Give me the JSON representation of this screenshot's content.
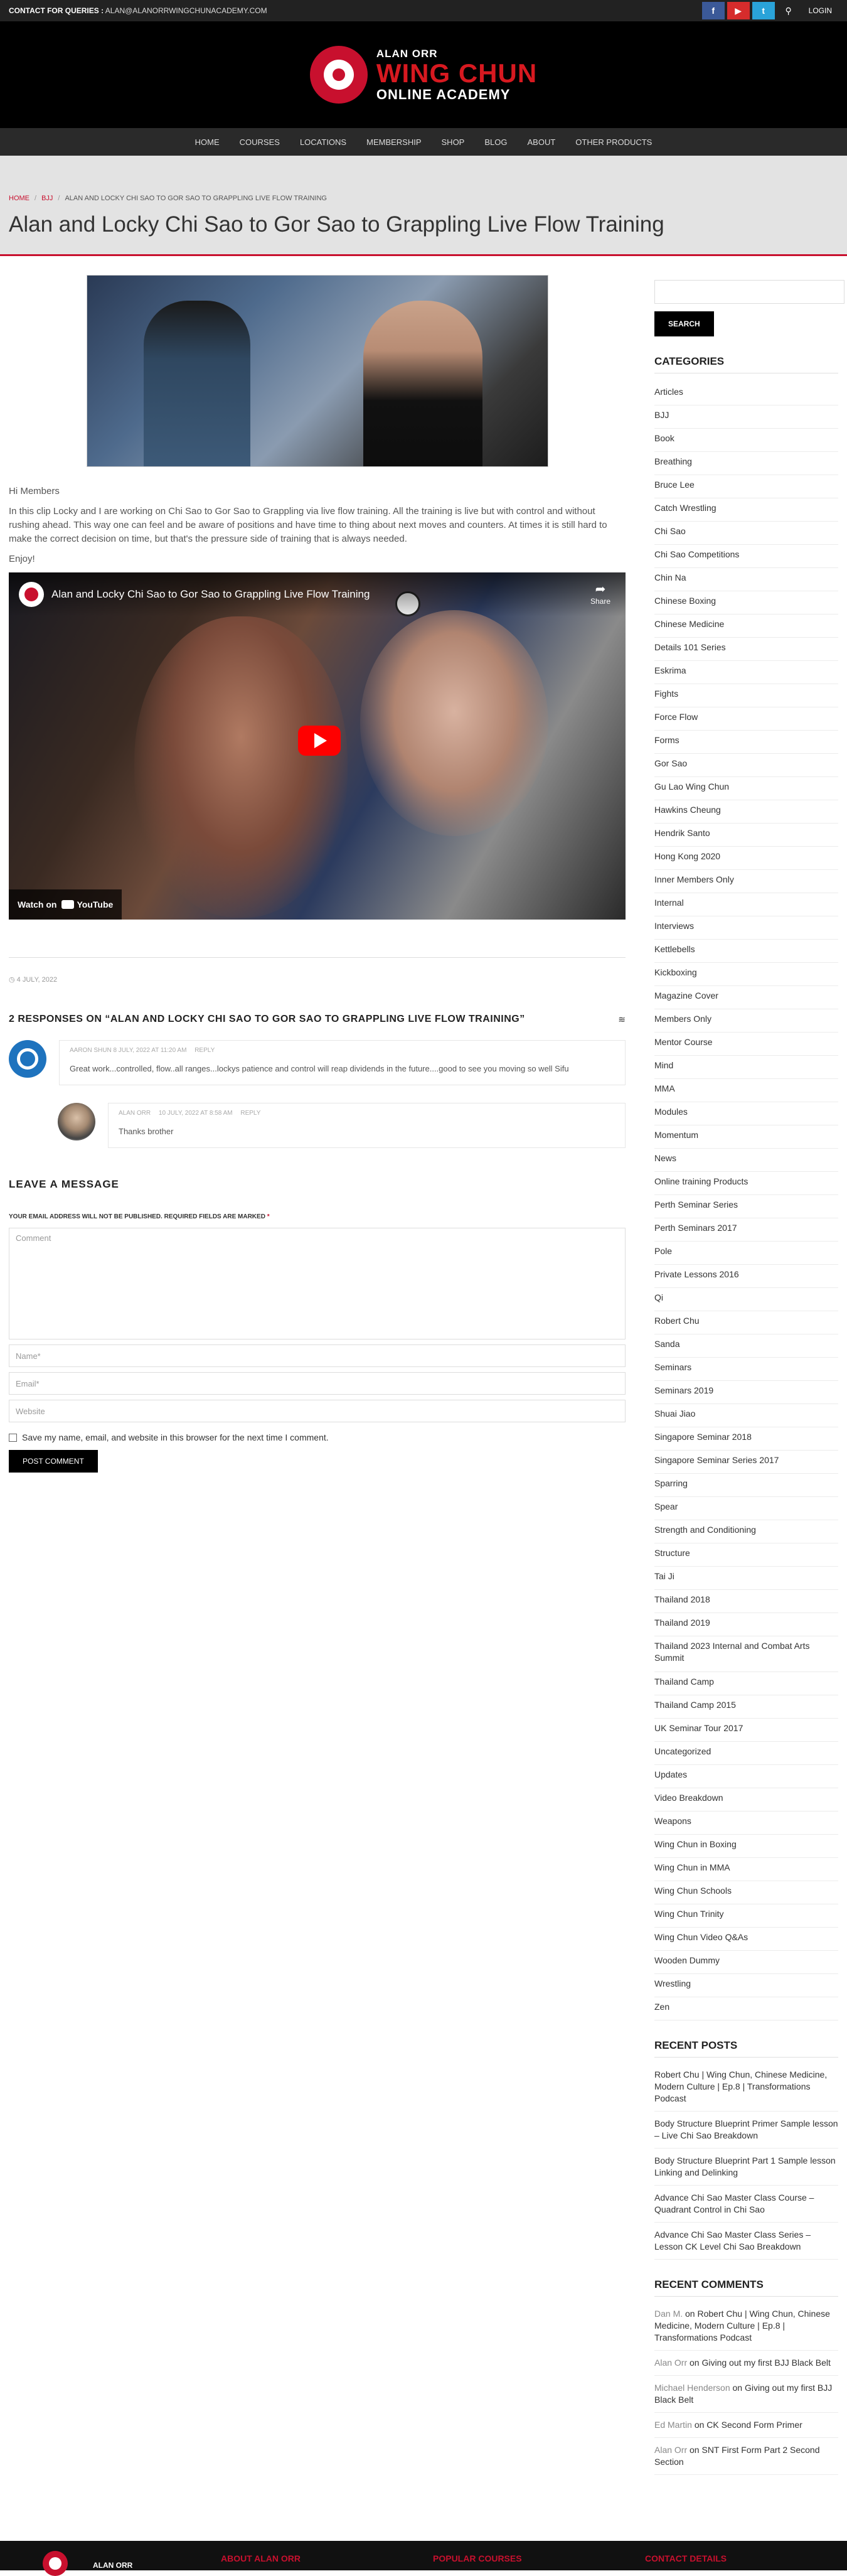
{
  "topbar": {
    "contact_label": "CONTACT FOR QUERIES :",
    "email": "ALAN@ALANORRWINGCHUNACADEMY.COM",
    "login": "LOGIN"
  },
  "logo": {
    "line1": "ALAN ORR",
    "line2": "WING CHUN",
    "line3": "ONLINE ACADEMY"
  },
  "nav": [
    "HOME",
    "COURSES",
    "LOCATIONS",
    "MEMBERSHIP",
    "SHOP",
    "BLOG",
    "ABOUT",
    "OTHER PRODUCTS"
  ],
  "breadcrumb": {
    "home": "HOME",
    "cat": "BJJ",
    "current": "ALAN AND LOCKY CHI SAO TO GOR SAO TO GRAPPLING LIVE FLOW TRAINING"
  },
  "page_title": "Alan and Locky Chi Sao to Gor Sao to Grappling Live Flow Training",
  "post": {
    "greeting": "Hi Members",
    "body": "In this clip Locky and I are working on Chi Sao to Gor Sao to Grappling via live flow training. All the training is live but with control and without rushing ahead. This way one can feel and be aware of positions and have time to thing about next moves and counters. At times it is still hard to make the correct decision on time, but that's the pressure side of training that is always needed.",
    "signoff": "Enjoy!",
    "date": "4 JULY, 2022"
  },
  "video": {
    "title": "Alan and Locky Chi Sao to Gor Sao to Grappling Live Flow Training",
    "share": "Share",
    "watch_on": "Watch on",
    "youtube": "YouTube"
  },
  "responses": {
    "heading": "2 RESPONSES ON “ALAN AND LOCKY CHI SAO TO GOR SAO TO GRAPPLING LIVE FLOW TRAINING”",
    "items": [
      {
        "author": "AARON SHUN",
        "date": "8 JULY, 2022 AT 11:20 AM",
        "reply": "REPLY",
        "text": "Great work...controlled, flow..all ranges...lockys patience and control will reap dividends in the future....good to see you moving so well Sifu"
      },
      {
        "author": "ALAN ORR",
        "date": "10 JULY, 2022 AT 8:58 AM",
        "reply": "REPLY",
        "text": "Thanks brother"
      }
    ]
  },
  "leave": {
    "heading": "LEAVE A MESSAGE",
    "note": "YOUR EMAIL ADDRESS WILL NOT BE PUBLISHED. REQUIRED FIELDS ARE MARKED",
    "req": "*",
    "comment_ph": "Comment",
    "name_ph": "Name*",
    "email_ph": "Email*",
    "website_ph": "Website",
    "save_label": "Save my name, email, and website in this browser for the next time I comment.",
    "post_button": "POST COMMENT"
  },
  "sidebar": {
    "search_button": "SEARCH",
    "categories_title": "CATEGORIES",
    "categories": [
      "Articles",
      "BJJ",
      "Book",
      "Breathing",
      "Bruce Lee",
      "Catch Wrestling",
      "Chi Sao",
      "Chi Sao Competitions",
      "Chin Na",
      "Chinese Boxing",
      "Chinese Medicine",
      "Details 101 Series",
      "Eskrima",
      "Fights",
      "Force Flow",
      "Forms",
      "Gor Sao",
      "Gu Lao Wing Chun",
      "Hawkins Cheung",
      "Hendrik Santo",
      "Hong Kong 2020",
      "Inner Members Only",
      "Internal",
      "Interviews",
      "Kettlebells",
      "Kickboxing",
      "Magazine Cover",
      "Members Only",
      "Mentor Course",
      "Mind",
      "MMA",
      "Modules",
      "Momentum",
      "News",
      "Online training Products",
      "Perth Seminar Series",
      "Perth Seminars 2017",
      "Pole",
      "Private Lessons 2016",
      "Qi",
      "Robert Chu",
      "Sanda",
      "Seminars",
      "Seminars 2019",
      "Shuai Jiao",
      "Singapore Seminar 2018",
      "Singapore Seminar Series 2017",
      "Sparring",
      "Spear",
      "Strength and Conditioning",
      "Structure",
      "Tai Ji",
      "Thailand 2018",
      "Thailand 2019",
      "Thailand 2023 Internal and Combat Arts Summit",
      "Thailand Camp",
      "Thailand Camp 2015",
      "UK Seminar Tour 2017",
      "Uncategorized",
      "Updates",
      "Video Breakdown",
      "Weapons",
      "Wing Chun in Boxing",
      "Wing Chun in MMA",
      "Wing Chun Schools",
      "Wing Chun Trinity",
      "Wing Chun Video Q&As",
      "Wooden Dummy",
      "Wrestling",
      "Zen"
    ],
    "recent_posts_title": "RECENT POSTS",
    "recent_posts": [
      "Robert Chu | Wing Chun, Chinese Medicine, Modern Culture | Ep.8 | Transformations Podcast",
      "Body Structure Blueprint Primer Sample lesson – Live Chi Sao Breakdown",
      "Body Structure Blueprint Part 1 Sample lesson Linking and Delinking",
      "Advance Chi Sao Master Class Course – Quadrant Control in Chi Sao",
      "Advance Chi Sao Master Class Series – Lesson CK Level Chi Sao Breakdown"
    ],
    "recent_comments_title": "RECENT COMMENTS",
    "recent_comments": [
      {
        "author": "Dan M.",
        "on": "on",
        "post": "Robert Chu | Wing Chun, Chinese Medicine, Modern Culture | Ep.8 | Transformations Podcast"
      },
      {
        "author": "Alan Orr",
        "on": "on",
        "post": "Giving out my first BJJ Black Belt"
      },
      {
        "author": "Michael Henderson",
        "on": "on",
        "post": "Giving out my first BJJ Black Belt"
      },
      {
        "author": "Ed Martin",
        "on": "on",
        "post": "CK Second Form Primer"
      },
      {
        "author": "Alan Orr",
        "on": "on",
        "post": "SNT First Form Part 2 Second Section"
      }
    ]
  },
  "footer": {
    "brand": "ALAN ORR",
    "about": "ABOUT ALAN ORR",
    "courses": "POPULAR COURSES",
    "contact": "CONTACT DETAILS"
  },
  "colors": {
    "accent": "#c8102e",
    "nav_bg": "#2a2a2a",
    "title_band": "#e3e3e3"
  },
  "icons": [
    "facebook-icon",
    "youtube-icon",
    "twitter-icon",
    "search-icon",
    "rss-icon",
    "clock-icon",
    "play-icon",
    "share-icon"
  ]
}
